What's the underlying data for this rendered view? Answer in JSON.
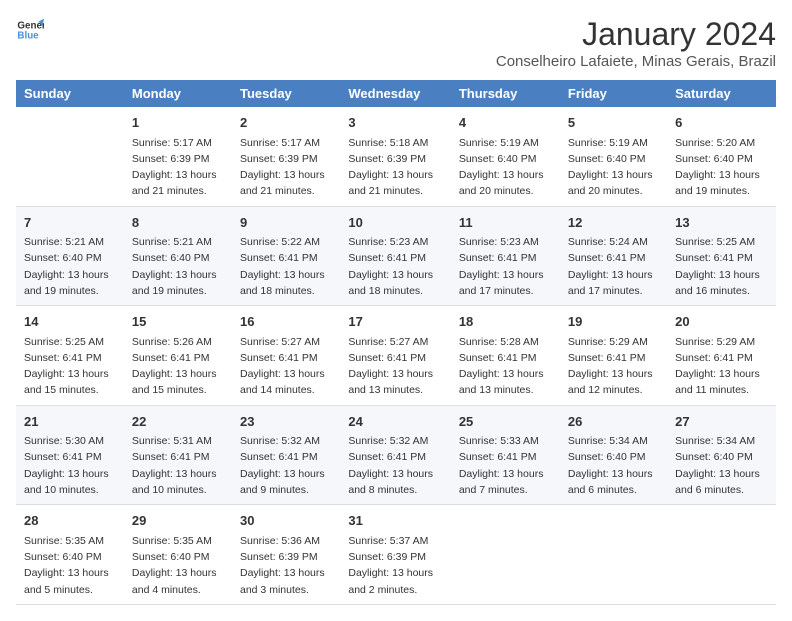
{
  "logo": {
    "line1": "General",
    "line2": "Blue"
  },
  "title": "January 2024",
  "subtitle": "Conselheiro Lafaiete, Minas Gerais, Brazil",
  "days_of_week": [
    "Sunday",
    "Monday",
    "Tuesday",
    "Wednesday",
    "Thursday",
    "Friday",
    "Saturday"
  ],
  "weeks": [
    [
      {
        "day": "",
        "sunrise": "",
        "sunset": "",
        "daylight": ""
      },
      {
        "day": "1",
        "sunrise": "Sunrise: 5:17 AM",
        "sunset": "Sunset: 6:39 PM",
        "daylight": "Daylight: 13 hours and 21 minutes."
      },
      {
        "day": "2",
        "sunrise": "Sunrise: 5:17 AM",
        "sunset": "Sunset: 6:39 PM",
        "daylight": "Daylight: 13 hours and 21 minutes."
      },
      {
        "day": "3",
        "sunrise": "Sunrise: 5:18 AM",
        "sunset": "Sunset: 6:39 PM",
        "daylight": "Daylight: 13 hours and 21 minutes."
      },
      {
        "day": "4",
        "sunrise": "Sunrise: 5:19 AM",
        "sunset": "Sunset: 6:40 PM",
        "daylight": "Daylight: 13 hours and 20 minutes."
      },
      {
        "day": "5",
        "sunrise": "Sunrise: 5:19 AM",
        "sunset": "Sunset: 6:40 PM",
        "daylight": "Daylight: 13 hours and 20 minutes."
      },
      {
        "day": "6",
        "sunrise": "Sunrise: 5:20 AM",
        "sunset": "Sunset: 6:40 PM",
        "daylight": "Daylight: 13 hours and 19 minutes."
      }
    ],
    [
      {
        "day": "7",
        "sunrise": "Sunrise: 5:21 AM",
        "sunset": "Sunset: 6:40 PM",
        "daylight": "Daylight: 13 hours and 19 minutes."
      },
      {
        "day": "8",
        "sunrise": "Sunrise: 5:21 AM",
        "sunset": "Sunset: 6:40 PM",
        "daylight": "Daylight: 13 hours and 19 minutes."
      },
      {
        "day": "9",
        "sunrise": "Sunrise: 5:22 AM",
        "sunset": "Sunset: 6:41 PM",
        "daylight": "Daylight: 13 hours and 18 minutes."
      },
      {
        "day": "10",
        "sunrise": "Sunrise: 5:23 AM",
        "sunset": "Sunset: 6:41 PM",
        "daylight": "Daylight: 13 hours and 18 minutes."
      },
      {
        "day": "11",
        "sunrise": "Sunrise: 5:23 AM",
        "sunset": "Sunset: 6:41 PM",
        "daylight": "Daylight: 13 hours and 17 minutes."
      },
      {
        "day": "12",
        "sunrise": "Sunrise: 5:24 AM",
        "sunset": "Sunset: 6:41 PM",
        "daylight": "Daylight: 13 hours and 17 minutes."
      },
      {
        "day": "13",
        "sunrise": "Sunrise: 5:25 AM",
        "sunset": "Sunset: 6:41 PM",
        "daylight": "Daylight: 13 hours and 16 minutes."
      }
    ],
    [
      {
        "day": "14",
        "sunrise": "Sunrise: 5:25 AM",
        "sunset": "Sunset: 6:41 PM",
        "daylight": "Daylight: 13 hours and 15 minutes."
      },
      {
        "day": "15",
        "sunrise": "Sunrise: 5:26 AM",
        "sunset": "Sunset: 6:41 PM",
        "daylight": "Daylight: 13 hours and 15 minutes."
      },
      {
        "day": "16",
        "sunrise": "Sunrise: 5:27 AM",
        "sunset": "Sunset: 6:41 PM",
        "daylight": "Daylight: 13 hours and 14 minutes."
      },
      {
        "day": "17",
        "sunrise": "Sunrise: 5:27 AM",
        "sunset": "Sunset: 6:41 PM",
        "daylight": "Daylight: 13 hours and 13 minutes."
      },
      {
        "day": "18",
        "sunrise": "Sunrise: 5:28 AM",
        "sunset": "Sunset: 6:41 PM",
        "daylight": "Daylight: 13 hours and 13 minutes."
      },
      {
        "day": "19",
        "sunrise": "Sunrise: 5:29 AM",
        "sunset": "Sunset: 6:41 PM",
        "daylight": "Daylight: 13 hours and 12 minutes."
      },
      {
        "day": "20",
        "sunrise": "Sunrise: 5:29 AM",
        "sunset": "Sunset: 6:41 PM",
        "daylight": "Daylight: 13 hours and 11 minutes."
      }
    ],
    [
      {
        "day": "21",
        "sunrise": "Sunrise: 5:30 AM",
        "sunset": "Sunset: 6:41 PM",
        "daylight": "Daylight: 13 hours and 10 minutes."
      },
      {
        "day": "22",
        "sunrise": "Sunrise: 5:31 AM",
        "sunset": "Sunset: 6:41 PM",
        "daylight": "Daylight: 13 hours and 10 minutes."
      },
      {
        "day": "23",
        "sunrise": "Sunrise: 5:32 AM",
        "sunset": "Sunset: 6:41 PM",
        "daylight": "Daylight: 13 hours and 9 minutes."
      },
      {
        "day": "24",
        "sunrise": "Sunrise: 5:32 AM",
        "sunset": "Sunset: 6:41 PM",
        "daylight": "Daylight: 13 hours and 8 minutes."
      },
      {
        "day": "25",
        "sunrise": "Sunrise: 5:33 AM",
        "sunset": "Sunset: 6:41 PM",
        "daylight": "Daylight: 13 hours and 7 minutes."
      },
      {
        "day": "26",
        "sunrise": "Sunrise: 5:34 AM",
        "sunset": "Sunset: 6:40 PM",
        "daylight": "Daylight: 13 hours and 6 minutes."
      },
      {
        "day": "27",
        "sunrise": "Sunrise: 5:34 AM",
        "sunset": "Sunset: 6:40 PM",
        "daylight": "Daylight: 13 hours and 6 minutes."
      }
    ],
    [
      {
        "day": "28",
        "sunrise": "Sunrise: 5:35 AM",
        "sunset": "Sunset: 6:40 PM",
        "daylight": "Daylight: 13 hours and 5 minutes."
      },
      {
        "day": "29",
        "sunrise": "Sunrise: 5:35 AM",
        "sunset": "Sunset: 6:40 PM",
        "daylight": "Daylight: 13 hours and 4 minutes."
      },
      {
        "day": "30",
        "sunrise": "Sunrise: 5:36 AM",
        "sunset": "Sunset: 6:39 PM",
        "daylight": "Daylight: 13 hours and 3 minutes."
      },
      {
        "day": "31",
        "sunrise": "Sunrise: 5:37 AM",
        "sunset": "Sunset: 6:39 PM",
        "daylight": "Daylight: 13 hours and 2 minutes."
      },
      {
        "day": "",
        "sunrise": "",
        "sunset": "",
        "daylight": ""
      },
      {
        "day": "",
        "sunrise": "",
        "sunset": "",
        "daylight": ""
      },
      {
        "day": "",
        "sunrise": "",
        "sunset": "",
        "daylight": ""
      }
    ]
  ]
}
